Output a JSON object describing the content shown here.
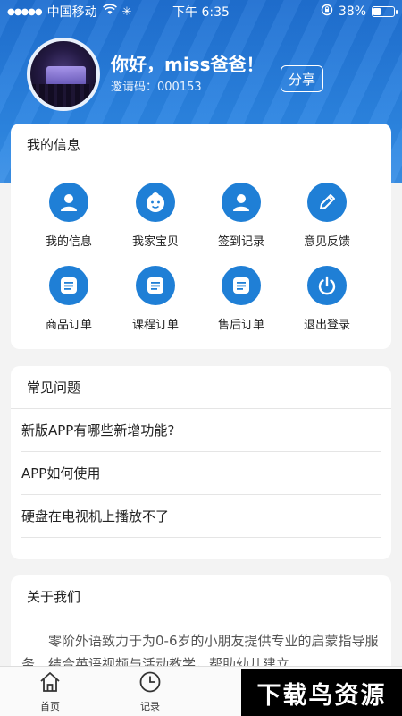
{
  "status_bar": {
    "carrier": "中国移动",
    "time": "下午 6:35",
    "battery": "38%",
    "battery_level": 0.38
  },
  "profile": {
    "greeting": "你好，miss爸爸！",
    "invite_label": "邀请码：000153",
    "share_label": "分享"
  },
  "my_info": {
    "title": "我的信息",
    "items": [
      {
        "label": "我的信息",
        "icon": "person-icon"
      },
      {
        "label": "我家宝贝",
        "icon": "baby-face-icon"
      },
      {
        "label": "签到记录",
        "icon": "person-icon"
      },
      {
        "label": "意见反馈",
        "icon": "pencil-icon"
      },
      {
        "label": "商品订单",
        "icon": "list-icon"
      },
      {
        "label": "课程订单",
        "icon": "list-icon"
      },
      {
        "label": "售后订单",
        "icon": "list-icon"
      },
      {
        "label": "退出登录",
        "icon": "power-icon"
      }
    ]
  },
  "faq": {
    "title": "常见问题",
    "items": [
      "新版APP有哪些新增功能?",
      "APP如何使用",
      "硬盘在电视机上播放不了"
    ]
  },
  "about": {
    "title": "关于我们",
    "text": "零阶外语致力于为0-6岁的小朋友提供专业的启蒙指导服务，结合英语视频与活动教学，帮助幼儿建立"
  },
  "tabbar": {
    "items": [
      {
        "label": "首页",
        "icon": "home-icon"
      },
      {
        "label": "记录",
        "icon": "clock-icon"
      }
    ]
  },
  "watermark": "下载鸟资源",
  "colors": {
    "accent": "#1f7fd6",
    "header_top": "#1f6fd1"
  }
}
